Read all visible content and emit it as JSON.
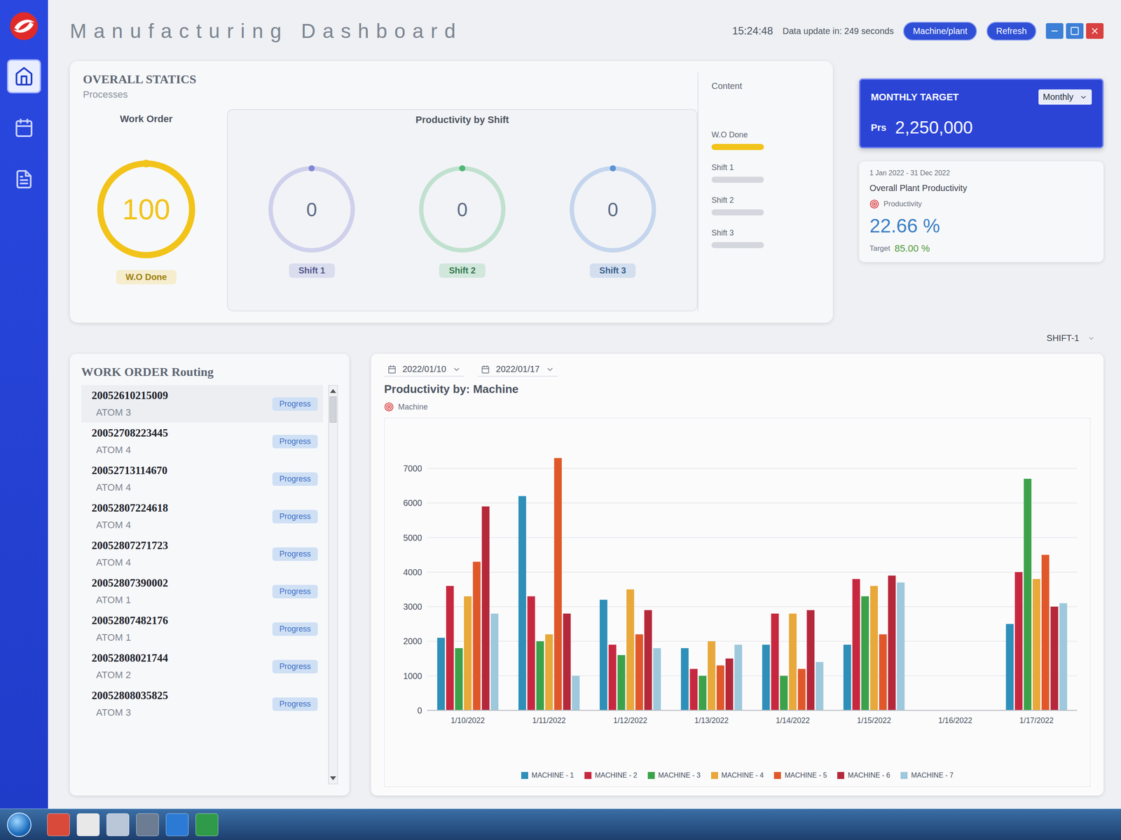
{
  "window": {
    "title": "Manufacturing Dashboard",
    "time": "15:24:48",
    "update": "Data update in: 249 seconds",
    "buttons": [
      "Machine/plant",
      "Refresh"
    ]
  },
  "sidebar": {
    "items": [
      {
        "selected": true
      },
      {
        "selected": false
      },
      {
        "selected": false
      }
    ]
  },
  "overall": {
    "title": "OVERALL STATICS",
    "subtitle": "Processes",
    "work_order": {
      "title": "Work Order",
      "value": "100",
      "label": "W.O Done",
      "level": 1,
      "color": "#f2c318"
    },
    "shift_title": "Productivity by Shift",
    "shifts": [
      {
        "value": "0",
        "label": "Shift 1",
        "level": 0,
        "color": "#7f86d4"
      },
      {
        "value": "0",
        "label": "Shift 2",
        "level": 0,
        "color": "#4fb877"
      },
      {
        "value": "0",
        "label": "Shift 3",
        "level": 0,
        "color": "#5b93d6"
      }
    ]
  },
  "content": {
    "title": "Content",
    "items": [
      {
        "label": "W.O Done",
        "level": 1,
        "color": "#f2c318"
      },
      {
        "label": "Shift 1",
        "level": 0,
        "color": "#c9ccd6"
      },
      {
        "label": "Shift 2",
        "level": 0,
        "color": "#c9ccd6"
      },
      {
        "label": "Shift 3",
        "level": 0,
        "color": "#c9ccd6"
      }
    ]
  },
  "monthly": {
    "title": "MONTHLY TARGET",
    "period": "Monthly",
    "unit": "Prs",
    "value": "2,250,000"
  },
  "plant": {
    "range": "1 Jan 2022 - 31 Dec 2022",
    "title": "Overall Plant Productivity",
    "legend": "Productivity",
    "value": "22.66 %",
    "target_label": "Target",
    "target": "85.00 %"
  },
  "shift_filter": "SHIFT-1",
  "work_orders": {
    "title": "WORK ORDER Routing",
    "rows": [
      {
        "id": "20052610215009",
        "machine": "ATOM 3",
        "status": "Progress"
      },
      {
        "id": "20052708223445",
        "machine": "ATOM 4",
        "status": "Progress"
      },
      {
        "id": "20052713114670",
        "machine": "ATOM 4",
        "status": "Progress"
      },
      {
        "id": "20052807224618",
        "machine": "ATOM 4",
        "status": "Progress"
      },
      {
        "id": "20052807271723",
        "machine": "ATOM 4",
        "status": "Progress"
      },
      {
        "id": "20052807390002",
        "machine": "ATOM 1",
        "status": "Progress"
      },
      {
        "id": "20052807482176",
        "machine": "ATOM 1",
        "status": "Progress"
      },
      {
        "id": "20052808021744",
        "machine": "ATOM 2",
        "status": "Progress"
      },
      {
        "id": "20052808035825",
        "machine": "ATOM 3",
        "status": "Progress"
      }
    ]
  },
  "chart": {
    "from": "2022/01/10",
    "to": "2022/01/17",
    "title": "Productivity by: Machine",
    "legend_label": "Machine",
    "y_ticks": [
      "0",
      "1000",
      "2000",
      "3000",
      "4000",
      "5000",
      "6000",
      "7000"
    ],
    "dates": [
      "1/10/2022",
      "1/11/2022",
      "1/12/2022",
      "1/13/2022",
      "1/14/2022",
      "1/15/2022",
      "1/16/2022",
      "1/17/2022"
    ],
    "series": [
      {
        "name": "MACHINE - 1",
        "color": "#2e8fb8",
        "values": [
          2100,
          6200,
          3200,
          1800,
          1900,
          1900,
          0,
          2500
        ]
      },
      {
        "name": "MACHINE - 2",
        "color": "#c8283f",
        "values": [
          3600,
          3300,
          1900,
          1200,
          2800,
          3800,
          0,
          4000
        ]
      },
      {
        "name": "MACHINE - 3",
        "color": "#3ba24a",
        "values": [
          1800,
          2000,
          1600,
          1000,
          1000,
          3300,
          0,
          6700
        ]
      },
      {
        "name": "MACHINE - 4",
        "color": "#e8a83a",
        "values": [
          3300,
          2200,
          3500,
          2000,
          2800,
          3600,
          0,
          3800
        ]
      },
      {
        "name": "MACHINE - 5",
        "color": "#e0582a",
        "values": [
          4300,
          7300,
          2200,
          1300,
          1200,
          2200,
          0,
          4500
        ]
      },
      {
        "name": "MACHINE - 6",
        "color": "#b5283a",
        "values": [
          5900,
          2800,
          2900,
          1500,
          2900,
          3900,
          0,
          3000
        ]
      },
      {
        "name": "MACHINE - 7",
        "color": "#9ec8db",
        "values": [
          2800,
          1000,
          1800,
          1900,
          1400,
          3700,
          0,
          3100
        ]
      }
    ]
  }
}
